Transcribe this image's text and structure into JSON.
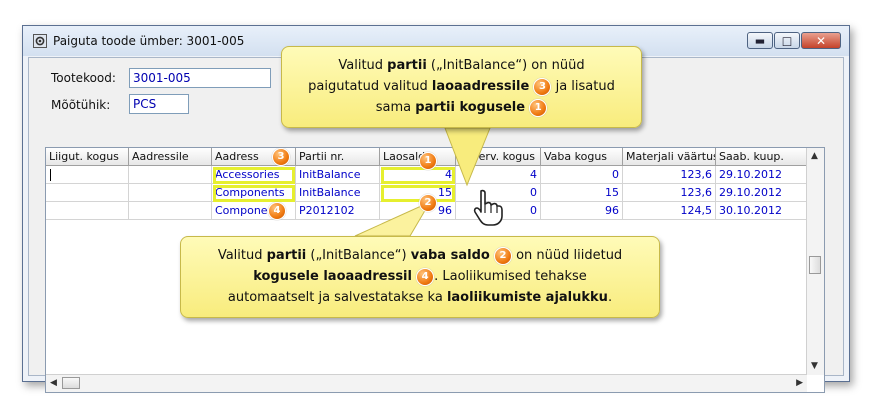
{
  "window": {
    "title": "Paiguta toode ümber: 3001-005",
    "controls": [
      "minimize-icon",
      "maximize-icon",
      "close-icon"
    ]
  },
  "form": {
    "product_code_label": "Tootekood:",
    "product_code_value": "3001-005",
    "unit_label": "Mõõtühik:",
    "unit_value": "PCS"
  },
  "table": {
    "columns": [
      "Liigut. kogus",
      "Aadressile",
      "Aadress",
      "Partii nr.",
      "Laosaldo",
      "Reserv. kogus",
      "Vaba kogus",
      "Materjali väärtus",
      "Saab. kuup."
    ],
    "rows": [
      [
        "",
        "",
        "Accessories",
        "InitBalance",
        "4",
        "4",
        "0",
        "123,6",
        "29.10.2012"
      ],
      [
        "",
        "",
        "Components",
        "InitBalance",
        "15",
        "0",
        "15",
        "123,6",
        "29.10.2012"
      ],
      [
        "",
        "",
        "Components",
        "P2012102",
        "96",
        "0",
        "96",
        "124,5",
        "30.10.2012"
      ]
    ]
  },
  "callouts": {
    "top": {
      "l1a": "Valitud ",
      "l1b": "partii",
      "l1c": " („InitBalance“) on nüüd",
      "l2a": "paigutatud valitud ",
      "l2b": "laoaadressile",
      "l2c": " ja lisatud",
      "l3a": "sama ",
      "l3b": "partii kogusele"
    },
    "bottom": {
      "l1a": "Valitud ",
      "l1b": "partii",
      "l1c": " („InitBalance“) ",
      "l1d": "vaba saldo",
      "l1e": " on nüüd liidetud",
      "l2a": "kogusele laoaadressil",
      "l2b": ".  Laoliikumised tehakse",
      "l3a": "automaatselt ja salvestatakse ka ",
      "l3b": "laoliikumiste ajalukku",
      "l3c": "."
    }
  },
  "badges": {
    "b1": "1",
    "b2": "2",
    "b3": "3",
    "b4": "4"
  },
  "colors": {
    "callout": "#fcf39b",
    "badge": "#f07a11",
    "highlight": "#e6ef2f",
    "cell_text": "#0000c8"
  }
}
